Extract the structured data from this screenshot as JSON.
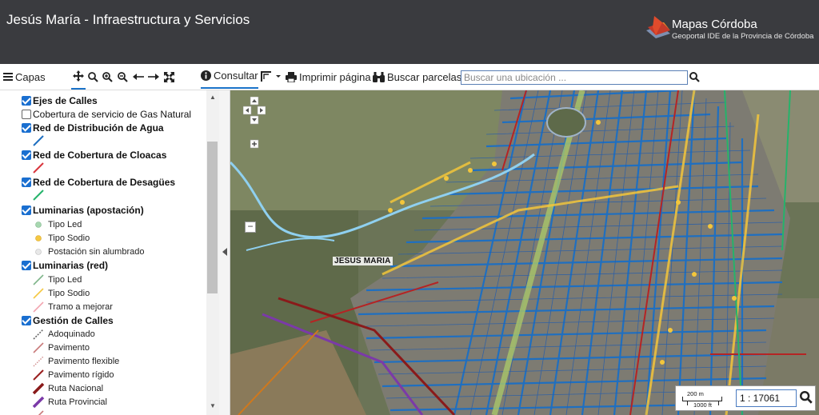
{
  "header": {
    "title": "Jesús María - Infraestructura y Servicios",
    "brand_name": "Mapas Córdoba",
    "brand_sub": "Geoportal IDE de la Provincia de Córdoba"
  },
  "toolbar": {
    "menu_label": "Capas",
    "consultar_label": "Consultar",
    "print_label": "Imprimir página",
    "parcel_label": "Buscar parcelas",
    "search_placeholder": "Buscar una ubicación ..."
  },
  "legend": {
    "layers": [
      {
        "label": "Ejes de Calles",
        "checked": true,
        "bold": true
      },
      {
        "label": "Cobertura de servicio de Gas Natural",
        "checked": false,
        "bold": false
      },
      {
        "label": "Red de Distribución de Agua",
        "checked": true,
        "bold": true
      },
      {
        "label": "Red de Cobertura de Cloacas",
        "checked": true,
        "bold": true
      },
      {
        "label": "Red de Cobertura de Desagües",
        "checked": true,
        "bold": true
      },
      {
        "label": "Luminarias (apostación)",
        "checked": true,
        "bold": true
      },
      {
        "label": "Luminarias (red)",
        "checked": true,
        "bold": true
      },
      {
        "label": "Gestión de Calles",
        "checked": true,
        "bold": true
      }
    ],
    "luminarias_apostacion": [
      "Tipo Led",
      "Tipo Sodio",
      "Postación sin alumbrado"
    ],
    "luminarias_red": [
      "Tipo Led",
      "Tipo Sodio",
      "Tramo a mejorar"
    ],
    "gestion_calles": [
      "Adoquinado",
      "Pavimento",
      "Pavimento flexible",
      "Pavimento rígido",
      "Ruta Nacional",
      "Ruta Provincial"
    ],
    "colors": {
      "agua": "#1f6fc0",
      "cloacas": "#d9363e",
      "desagues": "#25b36b",
      "led": "#a7d7b0",
      "sodio": "#f5c842",
      "sin_alumbrado": "#e8e8e8"
    }
  },
  "map": {
    "town_label": "JESUS MARIA",
    "scale_top": "200 m",
    "scale_bottom": "1000 ft",
    "scale_value": "1 : 17061",
    "zoom_minus": "−"
  }
}
